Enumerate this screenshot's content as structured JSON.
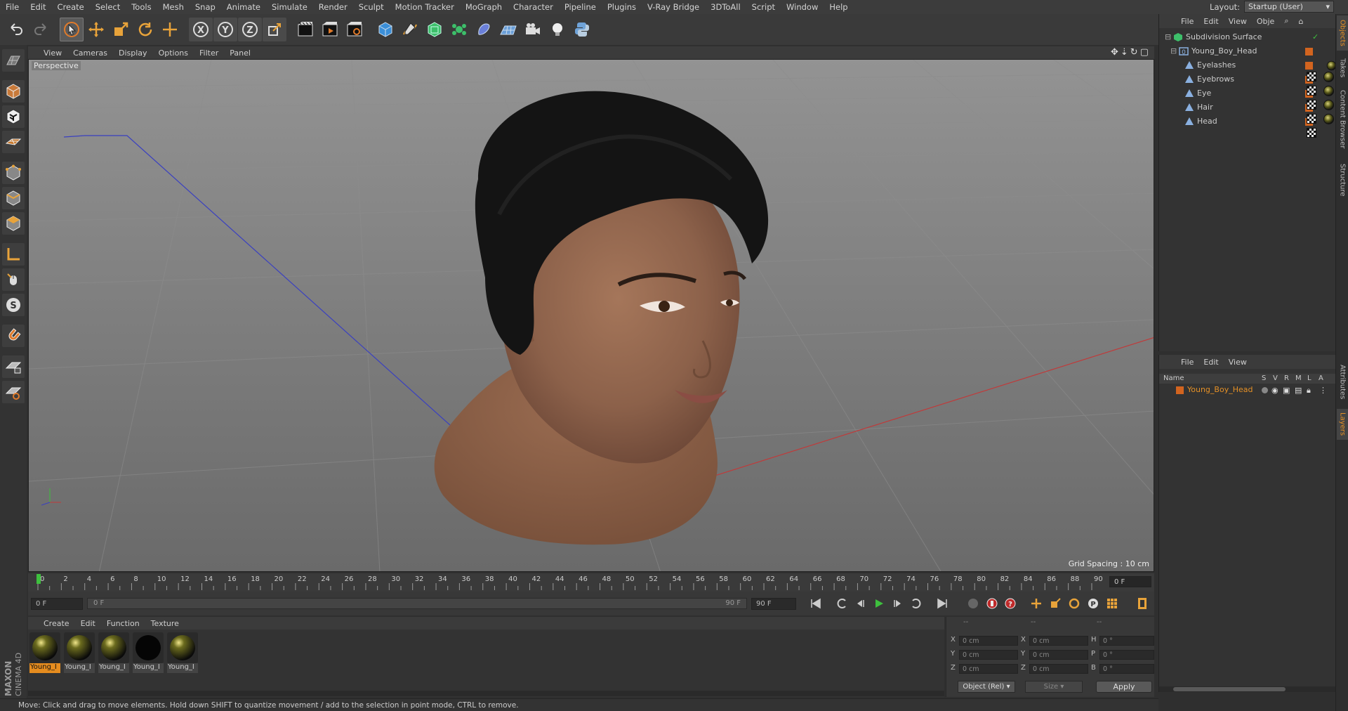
{
  "menubar": {
    "items": [
      "File",
      "Edit",
      "Create",
      "Select",
      "Tools",
      "Mesh",
      "Snap",
      "Animate",
      "Simulate",
      "Render",
      "Sculpt",
      "Motion Tracker",
      "MoGraph",
      "Character",
      "Pipeline",
      "Plugins",
      "V-Ray Bridge",
      "3DToAll",
      "Script",
      "Window",
      "Help"
    ],
    "layout_label": "Layout:",
    "layout_value": "Startup (User)"
  },
  "toolbar": {
    "icons": [
      "undo-icon",
      "redo-icon",
      "select-cursor-icon",
      "move-icon",
      "scale-icon",
      "rotate-icon",
      "live-selection-icon",
      "x-axis-icon",
      "y-axis-icon",
      "z-axis-icon",
      "coordinate-system-icon",
      "render-view-icon",
      "render-picture-viewer-icon",
      "edit-render-settings-icon",
      "cube-primitive-icon",
      "pen-spline-icon",
      "subdivision-icon",
      "array-generator-icon",
      "deformer-icon",
      "floor-icon",
      "camera-icon",
      "light-icon",
      "python-icon"
    ],
    "axis_labels": [
      "X",
      "Y",
      "Z"
    ]
  },
  "left_tools": [
    "make-editable-icon",
    "model-mode-icon",
    "texture-mode-icon",
    "workplane-icon",
    "point-mode-icon",
    "edge-mode-icon",
    "polygon-mode-icon",
    "axis-mode-icon",
    "tweak-mode-icon",
    "solo-mode-icon",
    "snap-magnet-icon",
    "lock-workplane-icon",
    "planar-workplane-icon"
  ],
  "viewport": {
    "menu": [
      "View",
      "Cameras",
      "Display",
      "Options",
      "Filter",
      "Panel"
    ],
    "label": "Perspective",
    "grid_spacing": "Grid Spacing : 10 cm",
    "nav_icons": [
      "move-view-icon",
      "dolly-view-icon",
      "rotate-view-icon",
      "maximize-view-icon"
    ]
  },
  "timeline": {
    "ticks": [
      "0",
      "2",
      "4",
      "6",
      "8",
      "10",
      "12",
      "14",
      "16",
      "18",
      "20",
      "22",
      "24",
      "26",
      "28",
      "30",
      "32",
      "34",
      "36",
      "38",
      "40",
      "42",
      "44",
      "46",
      "48",
      "50",
      "52",
      "54",
      "56",
      "58",
      "60",
      "62",
      "64",
      "66",
      "68",
      "70",
      "72",
      "74",
      "76",
      "78",
      "80",
      "82",
      "84",
      "86",
      "88",
      "90"
    ],
    "current_frame": "0 F"
  },
  "transport": {
    "start_field": "0 F",
    "range_start": "0 F",
    "range_end": "90 F",
    "end_field": "90 F"
  },
  "materials": {
    "menu": [
      "Create",
      "Edit",
      "Function",
      "Texture"
    ],
    "items": [
      {
        "label": "Young_I"
      },
      {
        "label": "Young_I"
      },
      {
        "label": "Young_I"
      },
      {
        "label": "Young_I"
      },
      {
        "label": "Young_I"
      }
    ]
  },
  "coordinates": {
    "headers": [
      "--",
      "--",
      "--"
    ],
    "rows": [
      {
        "a": "X",
        "av": "0 cm",
        "b": "X",
        "bv": "0 cm",
        "c": "H",
        "cv": "0 °"
      },
      {
        "a": "Y",
        "av": "0 cm",
        "b": "Y",
        "bv": "0 cm",
        "c": "P",
        "cv": "0 °"
      },
      {
        "a": "Z",
        "av": "0 cm",
        "b": "Z",
        "bv": "0 cm",
        "c": "B",
        "cv": "0 °"
      }
    ],
    "mode": "Object (Rel)",
    "size_mode": "Size",
    "apply": "Apply"
  },
  "status": "Move: Click and drag to move elements. Hold down SHIFT to quantize movement / add to the selection in point mode, CTRL to remove.",
  "object_manager": {
    "menu": [
      "File",
      "Edit",
      "View",
      "Obje"
    ],
    "objects": [
      {
        "name": "Subdivision Surface"
      },
      {
        "name": "Young_Boy_Head"
      },
      {
        "name": "Eyelashes"
      },
      {
        "name": "Eyebrows"
      },
      {
        "name": "Eye"
      },
      {
        "name": "Hair"
      },
      {
        "name": "Head"
      }
    ]
  },
  "layer_manager": {
    "menu": [
      "File",
      "Edit",
      "View"
    ],
    "columns": [
      "Name",
      "S",
      "V",
      "R",
      "M",
      "L",
      "A"
    ],
    "layer_name": "Young_Boy_Head"
  },
  "side_tabs": [
    "Objects",
    "Takes",
    "Content Browser",
    "Structure",
    "Attributes",
    "Layers"
  ],
  "brand": "MAXON CINEMA 4D",
  "colors": {
    "accent_orange": "#d2641f",
    "selection_orange": "#e58c1f",
    "skin": "#8a6048",
    "hair": "#141414"
  }
}
